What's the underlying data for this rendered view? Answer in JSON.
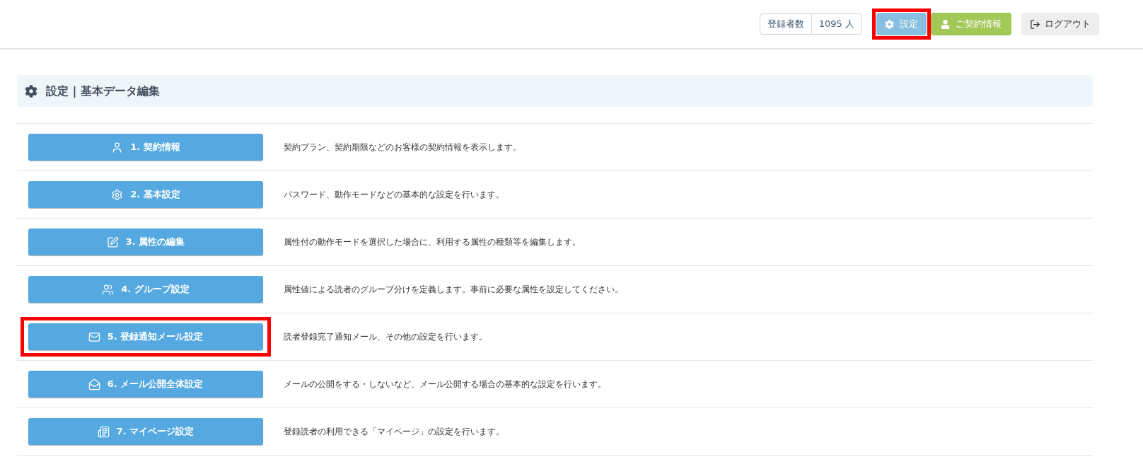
{
  "header": {
    "subscriber_count": {
      "label": "登録者数",
      "value": "1095 人"
    },
    "settings_button": {
      "label": "設定",
      "highlighted": true
    },
    "contract_button": {
      "label": "ご契約情報"
    },
    "logout_button": {
      "label": "ログアウト"
    }
  },
  "panel": {
    "title": "設定 | 基本データ編集"
  },
  "items": [
    {
      "kind": "user",
      "label": "1. 契約情報",
      "description": "契約プラン、契約期限などのお客様の契約情報を表示します。",
      "highlighted": false
    },
    {
      "kind": "gear",
      "label": "2. 基本設定",
      "description": "パスワード、動作モードなどの基本的な設定を行います。",
      "highlighted": false
    },
    {
      "kind": "edit",
      "label": "3. 属性の編集",
      "description": "属性付の動作モードを選択した場合に、利用する属性の種類等を編集します。",
      "highlighted": false
    },
    {
      "kind": "group",
      "label": "4. グループ設定",
      "description": "属性値による読者のグループ分けを定義します。事前に必要な属性を設定してください。",
      "highlighted": false
    },
    {
      "kind": "mail",
      "label": "5. 登録通知メール設定",
      "description": "読者登録完了通知メール、その他の設定を行います。",
      "highlighted": true
    },
    {
      "kind": "mail-open",
      "label": "6. メール公開全体設定",
      "description": "メールの公開をする・しないなど、メール公開する場合の基本的な設定を行います。",
      "highlighted": false
    },
    {
      "kind": "newspaper",
      "label": "7. マイページ設定",
      "description": "登録読者の利用できる「マイページ」の設定を行います。",
      "highlighted": false
    }
  ]
}
